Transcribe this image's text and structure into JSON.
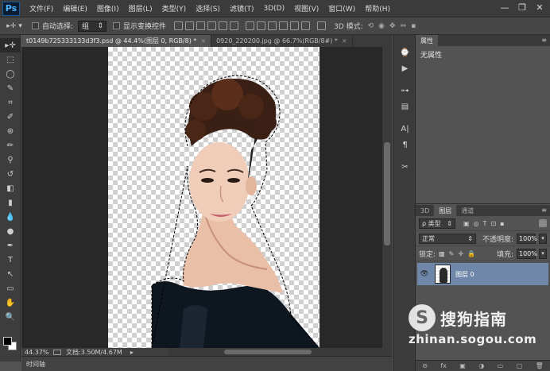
{
  "app": {
    "logo": "Ps",
    "menu": [
      "文件(F)",
      "编辑(E)",
      "图像(I)",
      "图层(L)",
      "类型(Y)",
      "选择(S)",
      "滤镜(T)",
      "3D(D)",
      "视图(V)",
      "窗口(W)",
      "帮助(H)"
    ],
    "window_controls": {
      "minimize": "—",
      "restore": "❐",
      "close": "✕"
    }
  },
  "options": {
    "tool_icon": "move-tool-icon",
    "auto_select_label": "自动选择:",
    "auto_select_value": "组",
    "show_transform_label": "显示变换控件",
    "mode_3d_label": "3D 模式:"
  },
  "tabs": [
    {
      "label": "t0149b725333133d3f3.psd @ 44.4%(图层 0, RGB/8) *",
      "close": "×",
      "active": true
    },
    {
      "label": "0920_220200.jpg @ 66.7%(RGB/8#) *",
      "close": "×",
      "active": false
    }
  ],
  "toolbar": {
    "tools": [
      "move-tool",
      "marquee-tool",
      "lasso-tool",
      "quick-select-tool",
      "crop-tool",
      "eyedropper-tool",
      "healing-brush-tool",
      "brush-tool",
      "clone-stamp-tool",
      "history-brush-tool",
      "eraser-tool",
      "gradient-tool",
      "blur-tool",
      "dodge-tool",
      "pen-tool",
      "type-tool",
      "path-select-tool",
      "shape-tool",
      "hand-tool",
      "zoom-tool"
    ],
    "glyphs": [
      "▸✛",
      "⬚",
      "◯",
      "✎",
      "⌗",
      "✐",
      "⊛",
      "✏",
      "⚲",
      "↺",
      "◧",
      "▮",
      "💧",
      "●",
      "✒",
      "T",
      "↖",
      "▭",
      "✋",
      "🔍"
    ]
  },
  "status": {
    "zoom": "44.37%",
    "doc_label": "文档:3.50M/4.67M",
    "arrow": "▸"
  },
  "timeline_label": "时间轴",
  "properties": {
    "tab": "属性",
    "menu": "≡",
    "body": "无属性"
  },
  "layers": {
    "tabs": [
      "3D",
      "图层",
      "通道"
    ],
    "filter_label": "ρ 类型",
    "filter_icons": [
      "▣",
      "◎",
      "T",
      "⊡",
      "▪"
    ],
    "blend_mode": "正常",
    "opacity_label": "不透明度:",
    "opacity_value": "100%",
    "lock_label": "锁定:",
    "lock_icons": [
      "▩",
      "✎",
      "✛",
      "🔒"
    ],
    "fill_label": "填充:",
    "fill_value": "100%",
    "items": [
      {
        "name": "图层 0",
        "visible": true
      }
    ],
    "footer_icons": [
      "⊝",
      "fx",
      "▣",
      "◑",
      "▭",
      "▢",
      "🗑"
    ]
  },
  "dock_icons": [
    "history-icon",
    "actions-icon",
    "adjustments-icon",
    "styles-icon",
    "character-icon",
    "paragraph-icon",
    "tool-presets-icon"
  ],
  "dock_glyphs": [
    "⌚",
    "▶",
    "⊶",
    "▤",
    "A|",
    "¶",
    "✂"
  ],
  "watermark": {
    "logo_letter": "S",
    "text": "搜狗指南",
    "url": "zhinan.sogou.com"
  },
  "colors": {
    "accent_selected_layer": "#6f87a8",
    "ps_logo": "#4fb4ff",
    "panel_bg": "#535353",
    "chrome_dark": "#3b3b3b"
  }
}
